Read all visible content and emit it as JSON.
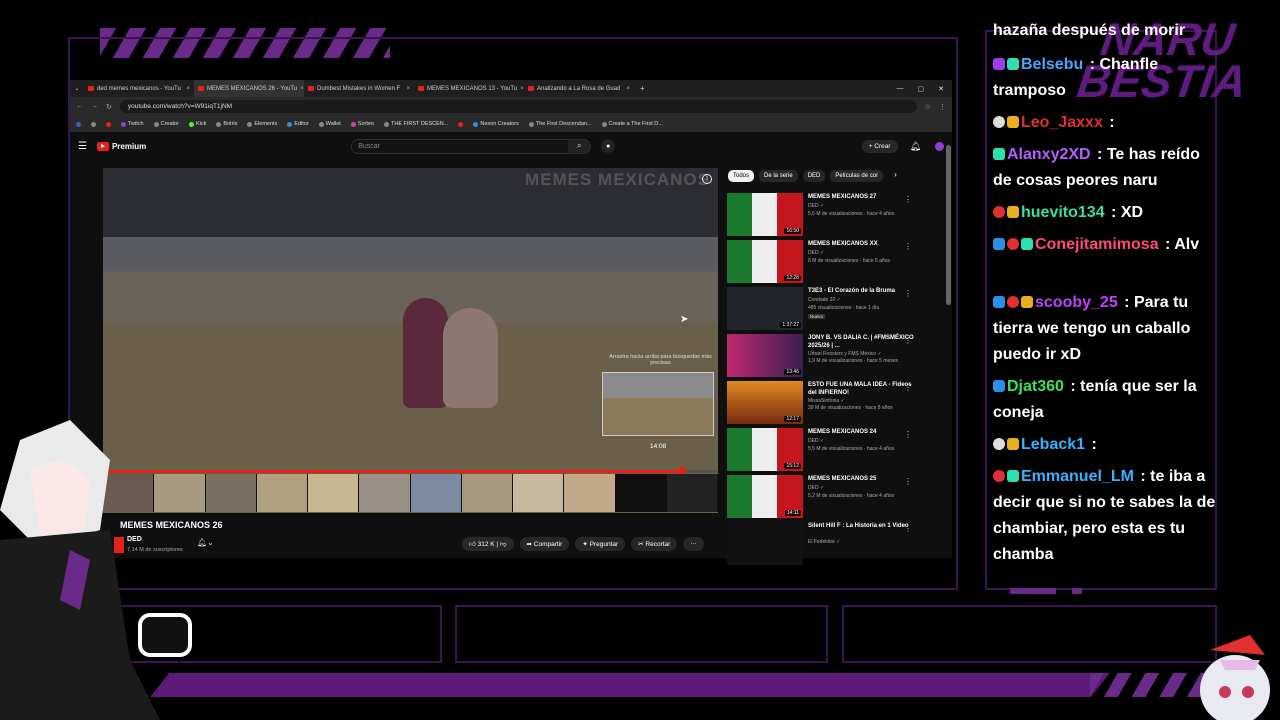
{
  "browser": {
    "tabs": [
      {
        "title": "ded memes mexicanos - YouTu",
        "active": false
      },
      {
        "title": "MEMES MEXICANOS 26 - YouTu",
        "active": true
      },
      {
        "title": "Dumbest Mistakes in Women F",
        "active": false
      },
      {
        "title": "MEMES MEXICANOS 13 - YouTu",
        "active": false
      },
      {
        "title": "Analizando a La Rosa de Guad",
        "active": false
      }
    ],
    "new_tab": "+",
    "url": "youtube.com/watch?v=W91iqT1jNM",
    "bookmarks": [
      "Twitch",
      "Creator",
      "Kick",
      "Botrix",
      "Elements",
      "Editor",
      "Wallet",
      "Sorteo",
      "THE FIRST DESCEN...",
      "Nexon Creators",
      "The First Descendan...",
      "Create a The First D..."
    ]
  },
  "youtube": {
    "logo": "Premium",
    "search_placeholder": "Buscar",
    "create_label": "+ Crear",
    "video": {
      "watermark": "MEMES MEXICANOS",
      "drag_hint": "Arrastra hacia arriba para búsquedas más precisas",
      "preview_time": "14:08",
      "progress": 0.94,
      "title": "MEMES MEXICANOS 26",
      "channel": "DED",
      "subscribers": "7,14 M de suscriptores",
      "actions": {
        "like": "312 K",
        "share": "Compartir",
        "ask": "Preguntar",
        "clip": "Recortar",
        "more": "···"
      }
    },
    "chips": [
      "Todos",
      "De la serie",
      "DED",
      "Películas de cor"
    ],
    "recommendations": [
      {
        "title": "MEMES MEXICANOS 27",
        "channel": "DED",
        "meta": "5,6 M de visualizaciones · hace 4 años",
        "duration": "16:50",
        "thumb": "mx"
      },
      {
        "title": "MEMES MEXICANOS XX",
        "channel": "DED",
        "meta": "8 M de visualizaciones · hace 5 años",
        "duration": "12:28",
        "thumb": "mx"
      },
      {
        "title": "T3E3 - El Corazón de la Bruma",
        "channel": "Condado 20",
        "meta": "485 visualizaciones · hace 1 día",
        "duration": "1:37:27",
        "thumb": "dark",
        "badge": "Nuevo"
      },
      {
        "title": "JONY B. VS DALIA C. | #FMSMÉXICO 2025/26 | ...",
        "channel": "Urban Roosters y FMS México",
        "meta": "1,9 M de visualizaciones · hace 5 meses",
        "duration": "13:46",
        "thumb": "pink"
      },
      {
        "title": "ESTO FUE UNA MALA IDEA - Fideos del INFIERNO!",
        "channel": "MissaSinfonia",
        "meta": "39 M de visualizaciones · hace 8 años",
        "duration": "12:17",
        "thumb": "orange"
      },
      {
        "title": "MEMES MEXICANOS 24",
        "channel": "DED",
        "meta": "5,5 M de visualizaciones · hace 4 años",
        "duration": "15:12",
        "thumb": "mx"
      },
      {
        "title": "MEMES MEXICANOS 25",
        "channel": "DED",
        "meta": "5,2 M de visualizaciones · hace 4 años",
        "duration": "14:11",
        "thumb": "mx"
      },
      {
        "title": "Silent Hill F : La Historia en 1 Video",
        "channel": "El Fedelobo",
        "meta": "",
        "duration": "",
        "thumb": "black"
      }
    ]
  },
  "chat": {
    "messages": [
      {
        "badges": [],
        "user": "",
        "text": "hazaña después de morir"
      },
      {
        "badges": [
          "purple",
          "green"
        ],
        "user": "Belsebu",
        "color": "#4aa6ff",
        "text": "Chanfle tramposo"
      },
      {
        "badges": [
          "white",
          "gold"
        ],
        "user": "Leo_Jaxxx",
        "color": "#e23030",
        "text": ""
      },
      {
        "badges": [
          "green"
        ],
        "user": "Alanxy2XD",
        "color": "#b55fff",
        "text": "Te has reído de cosas peores naru"
      },
      {
        "badges": [
          "red",
          "gold"
        ],
        "user": "huevito134",
        "color": "#3ce0a0",
        "text": "XD"
      },
      {
        "badges": [
          "blue",
          "red",
          "green"
        ],
        "user": "Conejitamimosa",
        "color": "#ff4a7a",
        "text": "Alv"
      },
      {
        "badges": [
          "blue",
          "red",
          "gold"
        ],
        "user": "scooby_25",
        "color": "#c040ff",
        "text": "Para tu tierra we tengo un caballo puedo ir xD"
      },
      {
        "badges": [
          "blue"
        ],
        "user": "Djat360",
        "color": "#3ce060",
        "text": "tenía que ser la coneja"
      },
      {
        "badges": [
          "white",
          "gold"
        ],
        "user": "Leback1",
        "color": "#3cb0ff",
        "text": ""
      },
      {
        "badges": [
          "red",
          "green"
        ],
        "user": "Emmanuel_LM",
        "color": "#3cb0ff",
        "text": "te iba a decir que si no te sabes la de chambiar, pero esta es tu chamba"
      }
    ],
    "logo_text": "NARU BESTIA"
  }
}
